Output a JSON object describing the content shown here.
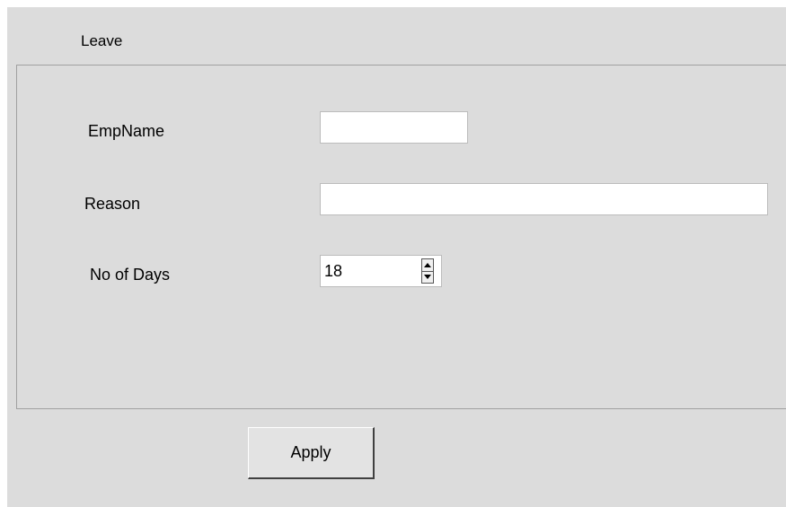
{
  "tab": {
    "label": "Leave"
  },
  "form": {
    "empname": {
      "label": "EmpName",
      "value": ""
    },
    "reason": {
      "label": "Reason",
      "value": ""
    },
    "days": {
      "label": "No of Days",
      "value": "18"
    }
  },
  "actions": {
    "apply_label": "Apply"
  },
  "colors": {
    "window_bg": "#dcdcdc",
    "input_bg": "#ffffff",
    "frame_border": "#a0a0a0"
  },
  "icons": {
    "spin_up": "triangle-up-icon",
    "spin_down": "triangle-down-icon"
  }
}
